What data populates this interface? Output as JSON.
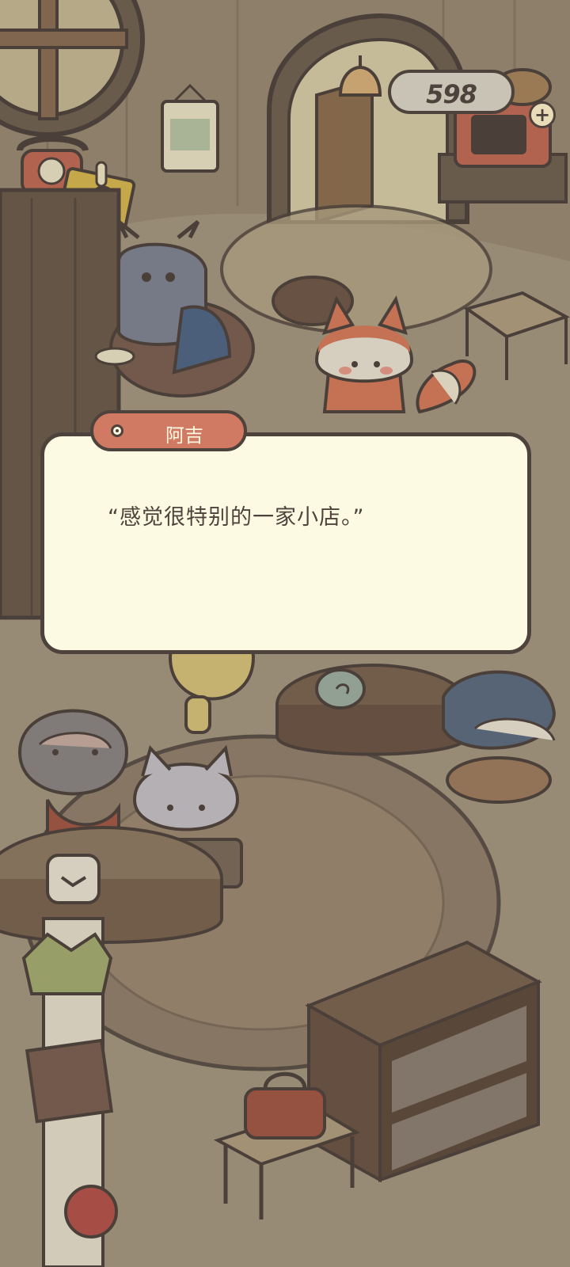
{
  "hud": {
    "currency_amount": "598"
  },
  "dialog": {
    "speaker": "阿吉",
    "line": "“感觉很特别的一家小店。”"
  },
  "colors": {
    "outline": "#4e433c",
    "dialog_bg": "#fdfae3",
    "name_tag": "#d07a64",
    "scene_bg": "#a89b84"
  },
  "icons": [
    "plus-icon",
    "speaker-dot-icon"
  ]
}
